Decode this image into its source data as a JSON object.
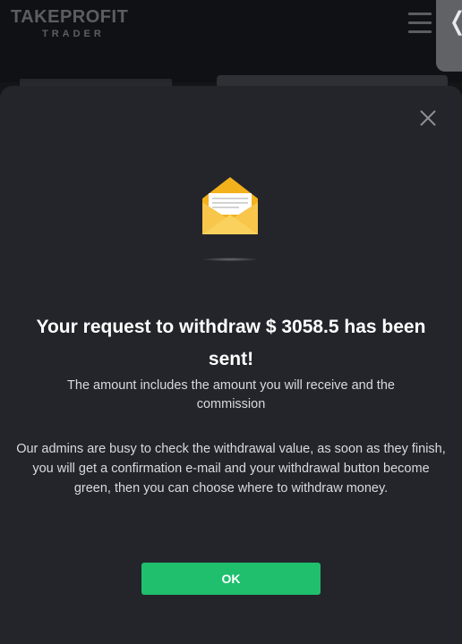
{
  "header": {
    "logo_line1": "TAKEPROFIT",
    "logo_line2": "TRADER",
    "menu_icon": "hamburger-menu-icon",
    "side_tab_icon": "chevron-left-icon",
    "side_tab_glyph": "❬"
  },
  "modal": {
    "close_icon": "close-icon",
    "illustration_icon": "envelope-icon",
    "title": "Your request to withdraw $ 3058.5 has been sent!",
    "subtitle": "The amount includes the amount you will receive and the commission",
    "description": "Our admins are busy to check the withdrawal value, as soon as they finish, you will get a confirmation e-mail and your withdrawal button become green, then you can choose where to withdraw money.",
    "ok_label": "OK"
  },
  "colors": {
    "modal_background": "#23252a",
    "page_background": "#131519",
    "button_green": "#1fbf6e",
    "envelope_yellow": "#f7c326",
    "text_white": "#ffffff"
  }
}
